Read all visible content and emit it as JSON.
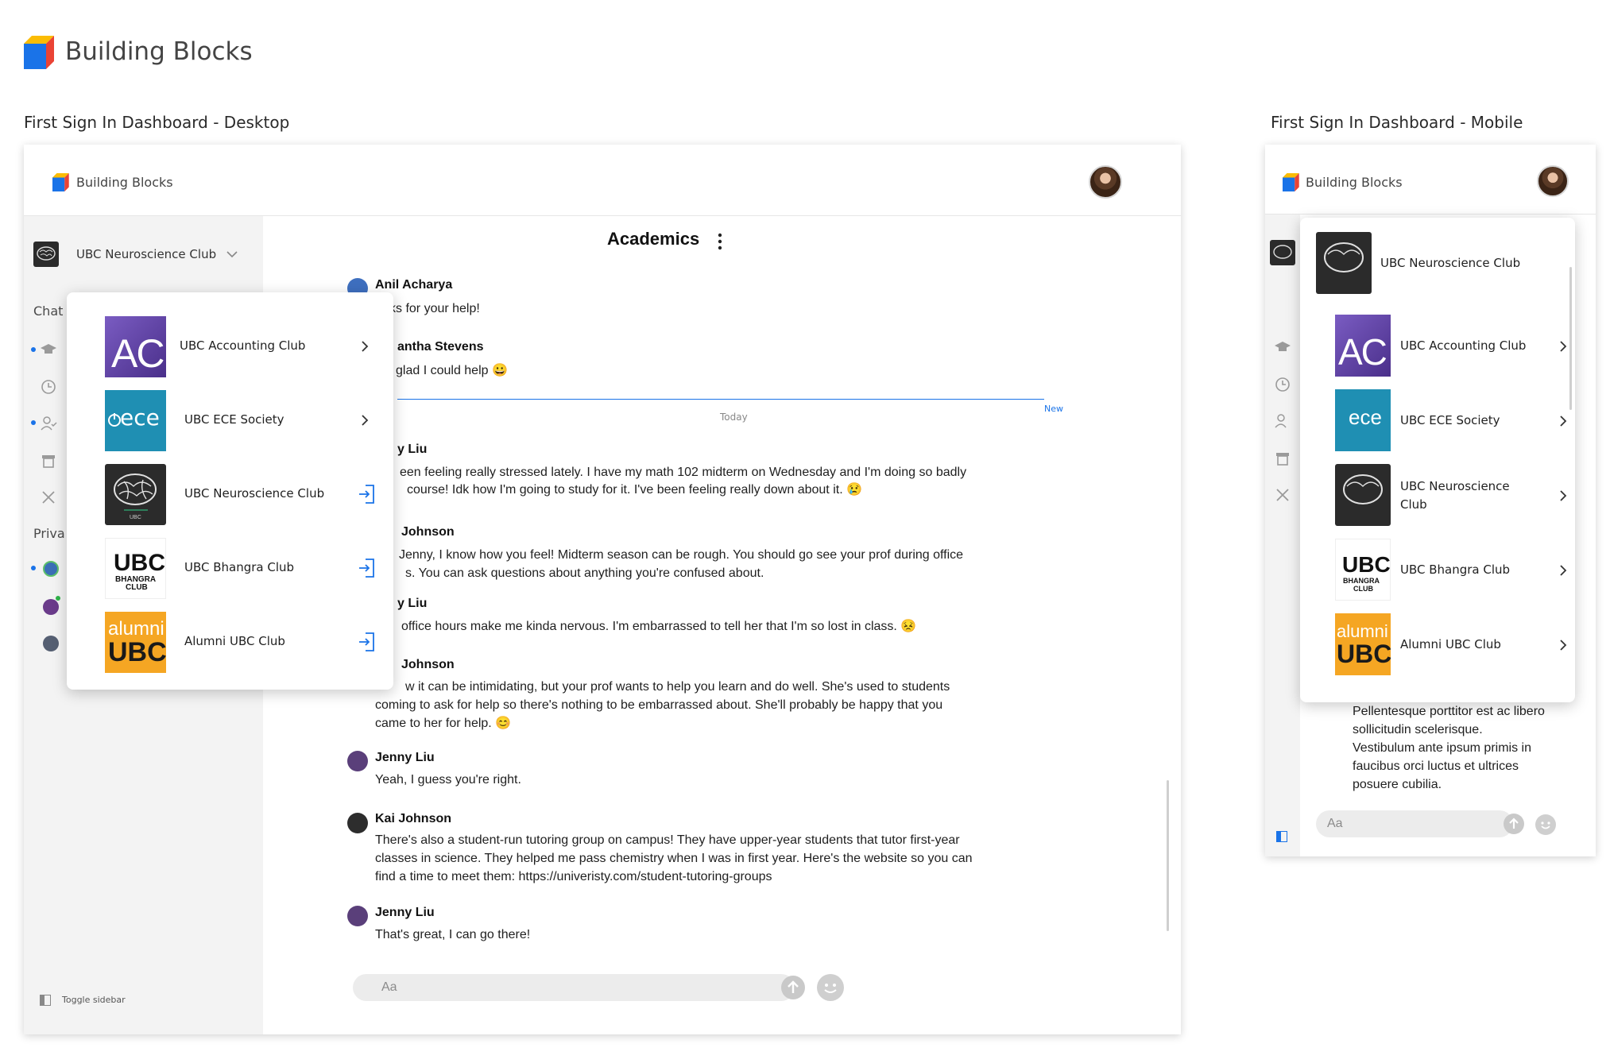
{
  "brand": {
    "name": "Building Blocks"
  },
  "frames": {
    "desktop_title": "First Sign In Dashboard - Desktop",
    "mobile_title": "First Sign In Dashboard - Mobile"
  },
  "desktop": {
    "topbar": {
      "brand": "Building Blocks"
    },
    "sidebar": {
      "current_club": "UBC Neuroscience Club",
      "section_chats": "Chat",
      "section_private": "Priva",
      "toggle_label": "Toggle sidebar"
    },
    "dropdown": {
      "items": [
        {
          "label": "UBC Accounting Club",
          "action": "chevron-right-icon",
          "logo_text": "AC"
        },
        {
          "label": "UBC ECE Society",
          "action": "chevron-right-icon",
          "logo_text": "ece"
        },
        {
          "label": "UBC Neuroscience Club",
          "action": "enter-icon",
          "logo_text": "UBC"
        },
        {
          "label": "UBC Bhangra Club",
          "action": "enter-icon",
          "logo_text_1": "UBC",
          "logo_text_2": "BHANGRA",
          "logo_text_3": "CLUB"
        },
        {
          "label": "Alumni UBC Club",
          "action": "enter-icon",
          "logo_text_1": "alumni",
          "logo_text_2": "UBC"
        }
      ]
    },
    "chat": {
      "title": "Academics",
      "divider_label": "Today",
      "new_label": "New",
      "messages": [
        {
          "name": "Anil Acharya",
          "text": "ks for your help!"
        },
        {
          "name": "antha Stevens",
          "text": "glad I could help 😀"
        },
        {
          "name": "y Liu",
          "text_1": "een feeling really stressed lately. I have my math 102 midterm on Wednesday and I'm doing so badly",
          "text_2": "course! Idk how I'm going to study for it. I've been feeling really down about it. 😢"
        },
        {
          "name": "Johnson",
          "text_1": "Jenny, I know how you feel! Midterm season can be rough. You should go see your prof during office",
          "text_2": "s. You can ask questions about anything you're confused about."
        },
        {
          "name": "y Liu",
          "text": "office hours make me kinda nervous. I'm embarrassed to tell her that I'm so lost in class. 😣"
        },
        {
          "name": "Johnson",
          "text_1": "w it can be intimidating, but your prof wants to help you learn and do well. She's used to students",
          "text_2": "coming to ask for help so there's nothing to be embarrassed about. She'll probably be happy that you",
          "text_3": "came to her for help. 😊"
        },
        {
          "name": "Jenny Liu",
          "text": "Yeah, I guess you're right."
        },
        {
          "name": "Kai Johnson",
          "text_1": "There's also a student-run tutoring group on campus! They have upper-year students that tutor first-year",
          "text_2": "classes in science. They helped me pass chemistry when I was in first year. Here's the website so you can",
          "text_3": "find a time to meet them: https://univeristy.com/student-tutoring-groups"
        },
        {
          "name": "Jenny Liu",
          "text": "That's great, I can go there!"
        }
      ],
      "composer_placeholder": "Aa"
    }
  },
  "mobile": {
    "topbar": {
      "brand": "Building Blocks"
    },
    "dropdown": {
      "current_club": "UBC Neuroscience Club",
      "items": [
        {
          "label": "UBC Accounting Club"
        },
        {
          "label": "UBC ECE Society"
        },
        {
          "label_1": "UBC Neuroscience",
          "label_2": "Club"
        },
        {
          "label": "UBC Bhangra Club"
        },
        {
          "label": "Alumni UBC Club"
        }
      ]
    },
    "message_lines": [
      "Pellentesque porttitor est ac libero",
      "sollicitudin scelerisque.",
      "Vestibulum ante ipsum primis in",
      "faucibus orci luctus et ultrices",
      "posuere cubilia."
    ],
    "composer_placeholder": "Aa"
  },
  "colors": {
    "accent": "#1a73e8",
    "accounting": "#5b3f98",
    "ece": "#1f8fb3",
    "alumni": "#f5a623",
    "sidebar_bg": "#f3f3f3"
  }
}
